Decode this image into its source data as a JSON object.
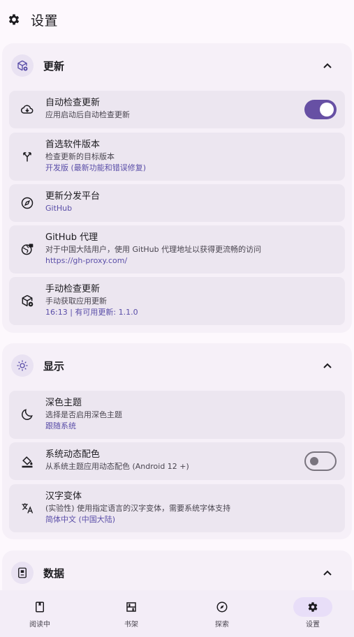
{
  "appbar": {
    "title": "设置",
    "icon": "gear-icon"
  },
  "sections": {
    "update": {
      "title": "更新",
      "icon": "package-update-icon",
      "items": {
        "auto_check": {
          "title": "自动检查更新",
          "subtitle": "应用启动后自动检查更新",
          "toggle": true
        },
        "channel": {
          "title": "首选软件版本",
          "subtitle": "检查更新的目标版本",
          "value": "开发版 (最新功能和错误修复)"
        },
        "platform": {
          "title": "更新分发平台",
          "value": "GitHub"
        },
        "proxy": {
          "title": "GitHub 代理",
          "subtitle": "对于中国大陆用户，使用 GitHub 代理地址以获得更流畅的访问",
          "value": "https://gh-proxy.com/"
        },
        "manual": {
          "title": "手动检查更新",
          "subtitle": "手动获取应用更新",
          "value": "16:13 | 有可用更新: 1.1.0"
        }
      }
    },
    "display": {
      "title": "显示",
      "icon": "brightness-icon",
      "items": {
        "dark": {
          "title": "深色主题",
          "subtitle": "选择是否启用深色主题",
          "value": "跟随系统"
        },
        "dynamic": {
          "title": "系统动态配色",
          "subtitle": "从系统主题应用动态配色 (Android 12 +)",
          "toggle": false
        },
        "hanzi": {
          "title": "汉字变体",
          "subtitle": "(实验性) 使用指定语言的汉字变体，需要系统字体支持",
          "value": "简体中文 (中国大陆)"
        }
      }
    },
    "data": {
      "title": "数据",
      "icon": "database-icon"
    }
  },
  "nav": {
    "reading": "阅读中",
    "shelf": "书架",
    "explore": "探索",
    "settings": "设置",
    "active": "settings"
  },
  "colors": {
    "accent": "#6750a4",
    "link": "#5a4ea8",
    "background": "#fdf8fd",
    "card": "#ece6f0"
  }
}
